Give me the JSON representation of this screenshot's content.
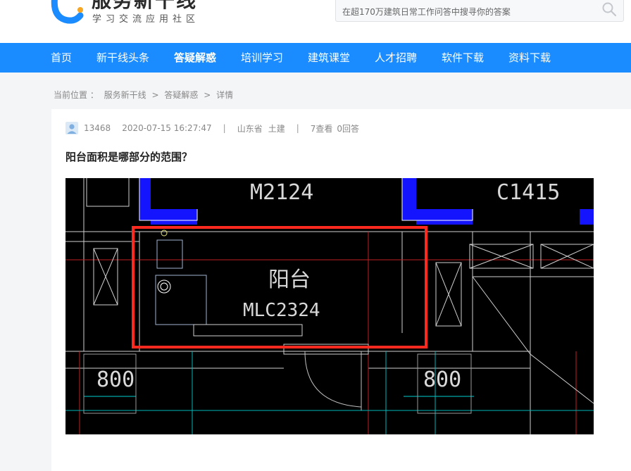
{
  "logo": {
    "title": "服务新干线",
    "subtitle": "学习交流应用社区"
  },
  "search": {
    "placeholder": "在超170万建筑日常工作问答中搜寻你的答案"
  },
  "nav": [
    {
      "label": "首页",
      "active": false
    },
    {
      "label": "新干线头条",
      "active": false
    },
    {
      "label": "答疑解惑",
      "active": true
    },
    {
      "label": "培训学习",
      "active": false
    },
    {
      "label": "建筑课堂",
      "active": false
    },
    {
      "label": "人才招聘",
      "active": false
    },
    {
      "label": "软件下载",
      "active": false
    },
    {
      "label": "资料下载",
      "active": false
    }
  ],
  "breadcrumb": {
    "prefix": "当前位置 ：",
    "items": [
      "服务新干线",
      "答疑解惑",
      "详情"
    ],
    "separator": ">"
  },
  "question": {
    "user_id": "13468",
    "datetime": "2020-07-15 16:27:47",
    "location": "山东省",
    "category": "土建",
    "views": "7查看",
    "answers": "0回答",
    "title": "阳台面积是哪部分的范围？"
  },
  "drawing": {
    "door_label": "M2124",
    "window_label_right": "C1415",
    "room_label": "阳台",
    "window_label": "MLC2324",
    "dim_left": "800",
    "dim_right": "800",
    "highlight_color": "#ff2a1f"
  },
  "colors": {
    "brand": "#1a8cff",
    "text": "#333333"
  }
}
